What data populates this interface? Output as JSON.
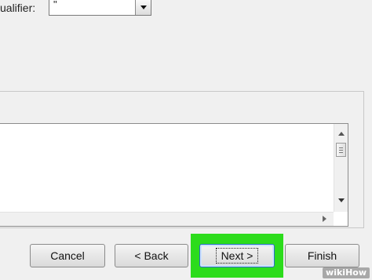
{
  "text_qualifier": {
    "label": "ualifier:",
    "value": "\""
  },
  "buttons": {
    "cancel": "Cancel",
    "back": "< Back",
    "next": "Next >",
    "finish": "Finish"
  },
  "watermark": "wikiHow",
  "colors": {
    "highlight": "#2cdc1c",
    "focus_border": "#2a6fc4"
  }
}
